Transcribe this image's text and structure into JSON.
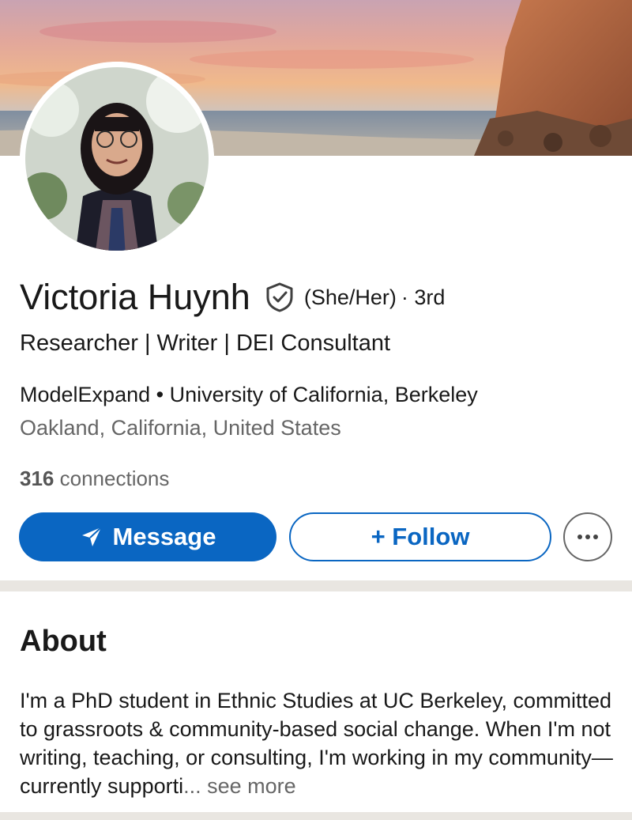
{
  "profile": {
    "name": "Victoria Huynh",
    "verified_icon": "shield-check-icon",
    "pronouns": "(She/Her)",
    "degree": "· 3rd",
    "headline": "Researcher | Writer | DEI Consultant",
    "company": "ModelExpand",
    "separator": "•",
    "school": "University of California, Berkeley",
    "location": "Oakland, California, United States",
    "connections_count": "316",
    "connections_label": "connections"
  },
  "actions": {
    "message_label": "Message",
    "message_icon": "send-icon",
    "follow_label": "+ Follow",
    "more_icon": "ellipsis-icon"
  },
  "about": {
    "title": "About",
    "text": "I'm a PhD student in Ethnic Studies at UC Berkeley, committed to grassroots & community-based social change. When I'm not writing, teaching, or consulting, I'm working in my community—currently supporti",
    "ellipsis": "...",
    "see_more": "see more"
  },
  "colors": {
    "primary": "#0a66c2",
    "text": "#191919",
    "secondary_text": "#666666",
    "divider": "#e9e6e1"
  }
}
